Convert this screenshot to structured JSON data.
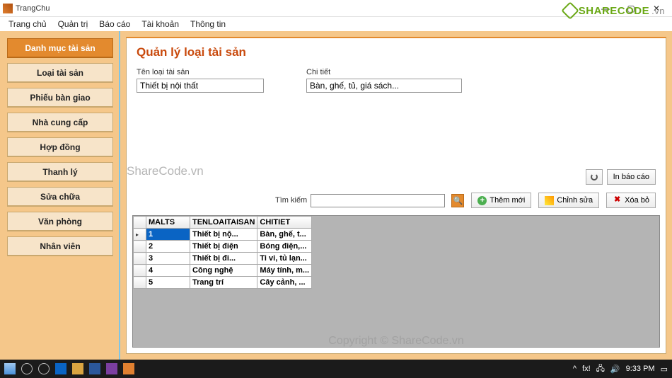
{
  "window": {
    "title": "TrangChu"
  },
  "menu": [
    "Trang chủ",
    "Quản trị",
    "Báo cáo",
    "Tài khoản",
    "Thông tin"
  ],
  "sidebar": {
    "items": [
      {
        "label": "Danh mục tài sản",
        "active": true
      },
      {
        "label": "Loại tài sản"
      },
      {
        "label": "Phiếu bàn giao"
      },
      {
        "label": "Nhà cung cấp"
      },
      {
        "label": "Hợp đồng"
      },
      {
        "label": "Thanh lý"
      },
      {
        "label": "Sửa chữa"
      },
      {
        "label": "Văn phòng"
      },
      {
        "label": "Nhân viên"
      }
    ]
  },
  "page": {
    "title": "Quản lý loại tài sản",
    "ten_label": "Tên loại tài sản",
    "ten_value": "Thiết bị nội thất",
    "chitiet_label": "Chi tiết",
    "chitiet_value": "Bàn, ghế, tủ, giá sách...",
    "search_label": "Tìm kiếm",
    "watermark": "ShareCode.vn",
    "copyright": "Copyright © ShareCode.vn"
  },
  "buttons": {
    "print_report": "In báo cáo",
    "add": "Thêm mới",
    "edit": "Chỉnh sửa",
    "delete": "Xóa bỏ"
  },
  "table": {
    "columns": [
      "MALTS",
      "TENLOAITAISAN",
      "CHITIET"
    ],
    "rows": [
      {
        "id": "1",
        "ten": "Thiết bị nộ...",
        "ct": "Bàn, ghế, t..."
      },
      {
        "id": "2",
        "ten": "Thiết bị điện",
        "ct": "Bóng điện,..."
      },
      {
        "id": "3",
        "ten": "Thiết bị đi...",
        "ct": "Ti vi, tủ lạn..."
      },
      {
        "id": "4",
        "ten": "Công nghệ",
        "ct": "Máy tính, m..."
      },
      {
        "id": "5",
        "ten": "Trang trí",
        "ct": "Cây cảnh, ..."
      }
    ]
  },
  "logo": {
    "name": "SHARECODE",
    "suffix": ".vn"
  },
  "taskbar": {
    "time": "9:33 PM",
    "date": ""
  }
}
